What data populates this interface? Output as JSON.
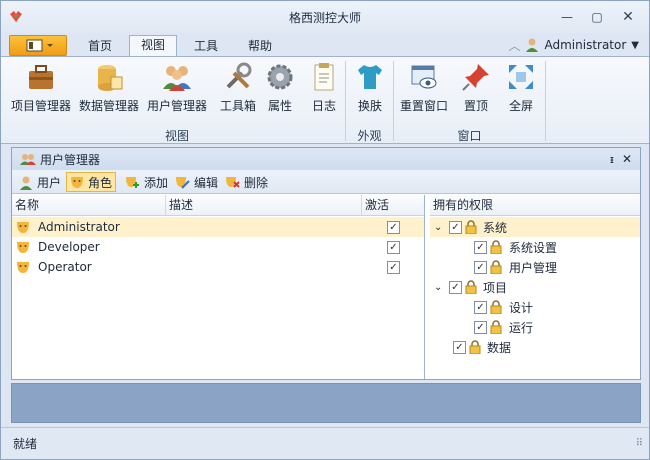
{
  "window": {
    "title": "格西测控大师",
    "icon": "app-logo-icon",
    "controls": [
      "minimize",
      "restore",
      "close"
    ]
  },
  "tabs": {
    "file_menu_icon": "layout-icon",
    "items": [
      "首页",
      "视图",
      "工具",
      "帮助"
    ],
    "active": "视图"
  },
  "user": {
    "icon": "user-icon",
    "name": "Administrator"
  },
  "ribbon": {
    "groups": [
      {
        "label": "视图",
        "buttons": [
          "项目管理器",
          "数据管理器",
          "用户管理器",
          "工具箱",
          "属性",
          "日志"
        ]
      },
      {
        "label": "外观",
        "buttons": [
          "换肤"
        ]
      },
      {
        "label": "窗口",
        "buttons": [
          "重置窗口",
          "置顶",
          "全屏"
        ]
      }
    ]
  },
  "panel": {
    "title": "用户管理器",
    "toolbar": {
      "user": "用户",
      "role": "角色",
      "add": "添加",
      "edit": "编辑",
      "delete": "删除",
      "active": "角色"
    },
    "grid": {
      "columns": [
        "名称",
        "描述",
        "激活"
      ],
      "rows": [
        {
          "name": "Administrator",
          "desc": "",
          "active": true
        },
        {
          "name": "Developer",
          "desc": "",
          "active": true
        },
        {
          "name": "Operator",
          "desc": "",
          "active": true
        }
      ],
      "selected": 0
    },
    "permissions": {
      "header": "拥有的权限",
      "nodes": [
        {
          "label": "系统",
          "level": 0,
          "expanded": true,
          "checked": true
        },
        {
          "label": "系统设置",
          "level": 1,
          "checked": true
        },
        {
          "label": "用户管理",
          "level": 1,
          "checked": true
        },
        {
          "label": "项目",
          "level": 0,
          "expanded": true,
          "checked": true
        },
        {
          "label": "设计",
          "level": 1,
          "checked": true
        },
        {
          "label": "运行",
          "level": 1,
          "checked": true
        },
        {
          "label": "数据",
          "level": 0,
          "checked": true
        }
      ]
    }
  },
  "status": {
    "text": "就绪"
  },
  "colors": {
    "accent": "#f5a623",
    "selection": "#fff1cc",
    "frame": "#8ea3bf",
    "status_panel": "#8ba4c5"
  }
}
